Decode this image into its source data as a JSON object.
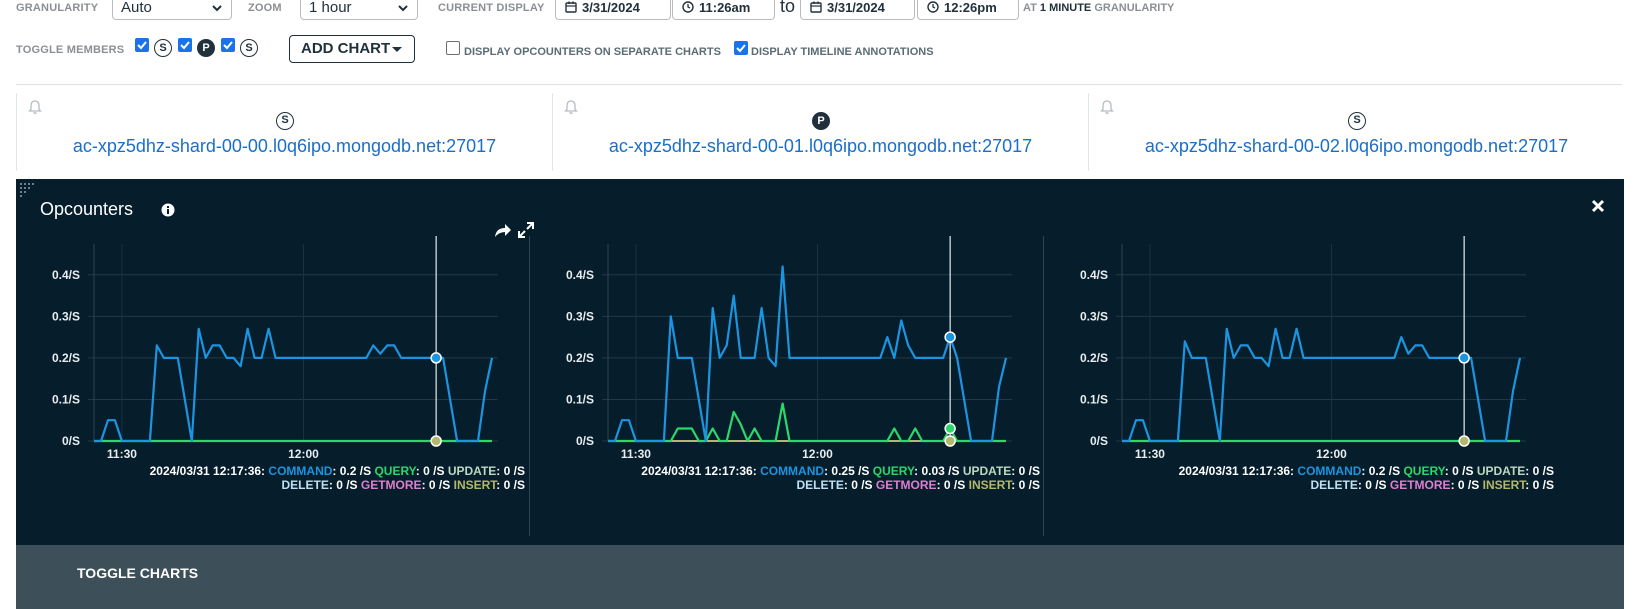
{
  "toolbar": {
    "granularity_label": "GRANULARITY",
    "granularity_value": "Auto",
    "zoom_label": "ZOOM",
    "zoom_value": "1 hour",
    "current_display_label": "CURRENT DISPLAY",
    "start_date": "3/31/2024",
    "start_time": "11:26am",
    "to_label": "to",
    "end_date": "3/31/2024",
    "end_time": "12:26pm",
    "granularity_note_prefix": "AT",
    "granularity_note_value": "1 MINUTE",
    "granularity_note_suffix": "GRANULARITY",
    "toggle_members_label": "TOGGLE MEMBERS",
    "member_badges": [
      "S",
      "P",
      "S"
    ],
    "add_chart_label": "ADD CHART",
    "separate_charts_label": "DISPLAY OPCOUNTERS ON SEPARATE CHARTS",
    "separate_charts_checked": false,
    "annotations_label": "DISPLAY TIMELINE ANNOTATIONS",
    "annotations_checked": true
  },
  "hosts": [
    {
      "role": "S",
      "name": "ac-xpz5dhz-shard-00-00.l0q6ipo.mongodb.net:27017"
    },
    {
      "role": "P",
      "name": "ac-xpz5dhz-shard-00-01.l0q6ipo.mongodb.net:27017"
    },
    {
      "role": "S",
      "name": "ac-xpz5dhz-shard-00-02.l0q6ipo.mongodb.net:27017"
    }
  ],
  "panel": {
    "title": "Opcounters",
    "toggle_charts_label": "TOGGLE CHARTS"
  },
  "colors": {
    "command": "#1b95e0",
    "query": "#2bd86a",
    "update": "#bcd9c0",
    "delete": "#bfe0f2",
    "getmore": "#de7fcf",
    "insert": "#b4b86a",
    "panel_bg": "#061d2b"
  },
  "chart_data": [
    {
      "type": "line",
      "ylim": [
        0,
        0.45
      ],
      "y_ticks": [
        "0/S",
        "0.1/S",
        "0.2/S",
        "0.3/S",
        "0.4/S"
      ],
      "x_ticks": [
        "11:30",
        "12:00"
      ],
      "hover_time": "2024/03/31 12:17:36:",
      "hover_index": 49,
      "legend": [
        {
          "name": "COMMAND",
          "value": "0.2 /S"
        },
        {
          "name": "QUERY",
          "value": "0 /S"
        },
        {
          "name": "UPDATE",
          "value": "0 /S"
        },
        {
          "name": "DELETE",
          "value": "0 /S"
        },
        {
          "name": "GETMORE",
          "value": "0 /S"
        },
        {
          "name": "INSERT",
          "value": "0 /S"
        }
      ],
      "series": [
        {
          "name": "COMMAND",
          "values": [
            0,
            0,
            0.05,
            0.05,
            0,
            0,
            0,
            0,
            0,
            0.23,
            0.2,
            0.2,
            0.2,
            0.1,
            0,
            0.27,
            0.2,
            0.23,
            0.23,
            0.2,
            0.2,
            0.18,
            0.27,
            0.2,
            0.2,
            0.27,
            0.2,
            0.2,
            0.2,
            0.2,
            0.2,
            0.2,
            0.2,
            0.2,
            0.2,
            0.2,
            0.2,
            0.2,
            0.2,
            0.2,
            0.23,
            0.21,
            0.23,
            0.23,
            0.2,
            0.2,
            0.2,
            0.2,
            0.2,
            0.2,
            0.2,
            0.1,
            0,
            0,
            0,
            0,
            0.12,
            0.2
          ]
        },
        {
          "name": "QUERY",
          "values": [
            0,
            0,
            0,
            0,
            0,
            0,
            0,
            0,
            0,
            0,
            0,
            0,
            0,
            0,
            0,
            0,
            0,
            0,
            0,
            0,
            0,
            0,
            0,
            0,
            0,
            0,
            0,
            0,
            0,
            0,
            0,
            0,
            0,
            0,
            0,
            0,
            0,
            0,
            0,
            0,
            0,
            0,
            0,
            0,
            0,
            0,
            0,
            0,
            0,
            0,
            0,
            0,
            0,
            0,
            0,
            0,
            0,
            0
          ]
        }
      ]
    },
    {
      "type": "line",
      "ylim": [
        0,
        0.45
      ],
      "y_ticks": [
        "0/S",
        "0.1/S",
        "0.2/S",
        "0.3/S",
        "0.4/S"
      ],
      "x_ticks": [
        "11:30",
        "12:00"
      ],
      "hover_time": "2024/03/31 12:17:36:",
      "hover_index": 49,
      "legend": [
        {
          "name": "COMMAND",
          "value": "0.25 /S"
        },
        {
          "name": "QUERY",
          "value": "0.03 /S"
        },
        {
          "name": "UPDATE",
          "value": "0 /S"
        },
        {
          "name": "DELETE",
          "value": "0 /S"
        },
        {
          "name": "GETMORE",
          "value": "0 /S"
        },
        {
          "name": "INSERT",
          "value": "0 /S"
        }
      ],
      "series": [
        {
          "name": "COMMAND",
          "values": [
            0,
            0,
            0.05,
            0.05,
            0,
            0,
            0,
            0,
            0,
            0.3,
            0.2,
            0.2,
            0.2,
            0.1,
            0,
            0.32,
            0.2,
            0.23,
            0.35,
            0.2,
            0.2,
            0.2,
            0.32,
            0.2,
            0.18,
            0.42,
            0.2,
            0.2,
            0.2,
            0.2,
            0.2,
            0.2,
            0.2,
            0.2,
            0.2,
            0.2,
            0.2,
            0.2,
            0.2,
            0.2,
            0.25,
            0.2,
            0.29,
            0.23,
            0.2,
            0.2,
            0.2,
            0.2,
            0.2,
            0.25,
            0.2,
            0.1,
            0,
            0,
            0,
            0,
            0.13,
            0.2
          ]
        },
        {
          "name": "QUERY",
          "values": [
            0,
            0,
            0,
            0,
            0,
            0,
            0,
            0,
            0,
            0,
            0.03,
            0.03,
            0.03,
            0,
            0,
            0.03,
            0,
            0,
            0.07,
            0.04,
            0,
            0.03,
            0,
            0,
            0,
            0.09,
            0,
            0,
            0,
            0,
            0,
            0,
            0,
            0,
            0,
            0,
            0,
            0,
            0,
            0,
            0,
            0.03,
            0,
            0,
            0.03,
            0,
            0,
            0,
            0,
            0.03,
            0,
            0,
            0,
            0,
            0,
            0,
            0,
            0
          ]
        }
      ]
    },
    {
      "type": "line",
      "ylim": [
        0,
        0.45
      ],
      "y_ticks": [
        "0/S",
        "0.1/S",
        "0.2/S",
        "0.3/S",
        "0.4/S"
      ],
      "x_ticks": [
        "11:30",
        "12:00"
      ],
      "hover_time": "2024/03/31 12:17:36:",
      "hover_index": 49,
      "legend": [
        {
          "name": "COMMAND",
          "value": "0.2 /S"
        },
        {
          "name": "QUERY",
          "value": "0 /S"
        },
        {
          "name": "UPDATE",
          "value": "0 /S"
        },
        {
          "name": "DELETE",
          "value": "0 /S"
        },
        {
          "name": "GETMORE",
          "value": "0 /S"
        },
        {
          "name": "INSERT",
          "value": "0 /S"
        }
      ],
      "series": [
        {
          "name": "COMMAND",
          "values": [
            0,
            0,
            0.05,
            0.05,
            0,
            0,
            0,
            0,
            0,
            0.24,
            0.2,
            0.2,
            0.2,
            0.1,
            0,
            0.27,
            0.2,
            0.23,
            0.23,
            0.2,
            0.2,
            0.18,
            0.27,
            0.2,
            0.2,
            0.27,
            0.2,
            0.2,
            0.2,
            0.2,
            0.2,
            0.2,
            0.2,
            0.2,
            0.2,
            0.2,
            0.2,
            0.2,
            0.2,
            0.2,
            0.25,
            0.21,
            0.23,
            0.23,
            0.2,
            0.2,
            0.2,
            0.2,
            0.2,
            0.2,
            0.2,
            0.1,
            0,
            0,
            0,
            0,
            0.12,
            0.2
          ]
        },
        {
          "name": "QUERY",
          "values": [
            0,
            0,
            0,
            0,
            0,
            0,
            0,
            0,
            0,
            0,
            0,
            0,
            0,
            0,
            0,
            0,
            0,
            0,
            0,
            0,
            0,
            0,
            0,
            0,
            0,
            0,
            0,
            0,
            0,
            0,
            0,
            0,
            0,
            0,
            0,
            0,
            0,
            0,
            0,
            0,
            0,
            0,
            0,
            0,
            0,
            0,
            0,
            0,
            0,
            0,
            0,
            0,
            0,
            0,
            0,
            0,
            0,
            0
          ]
        }
      ]
    }
  ]
}
